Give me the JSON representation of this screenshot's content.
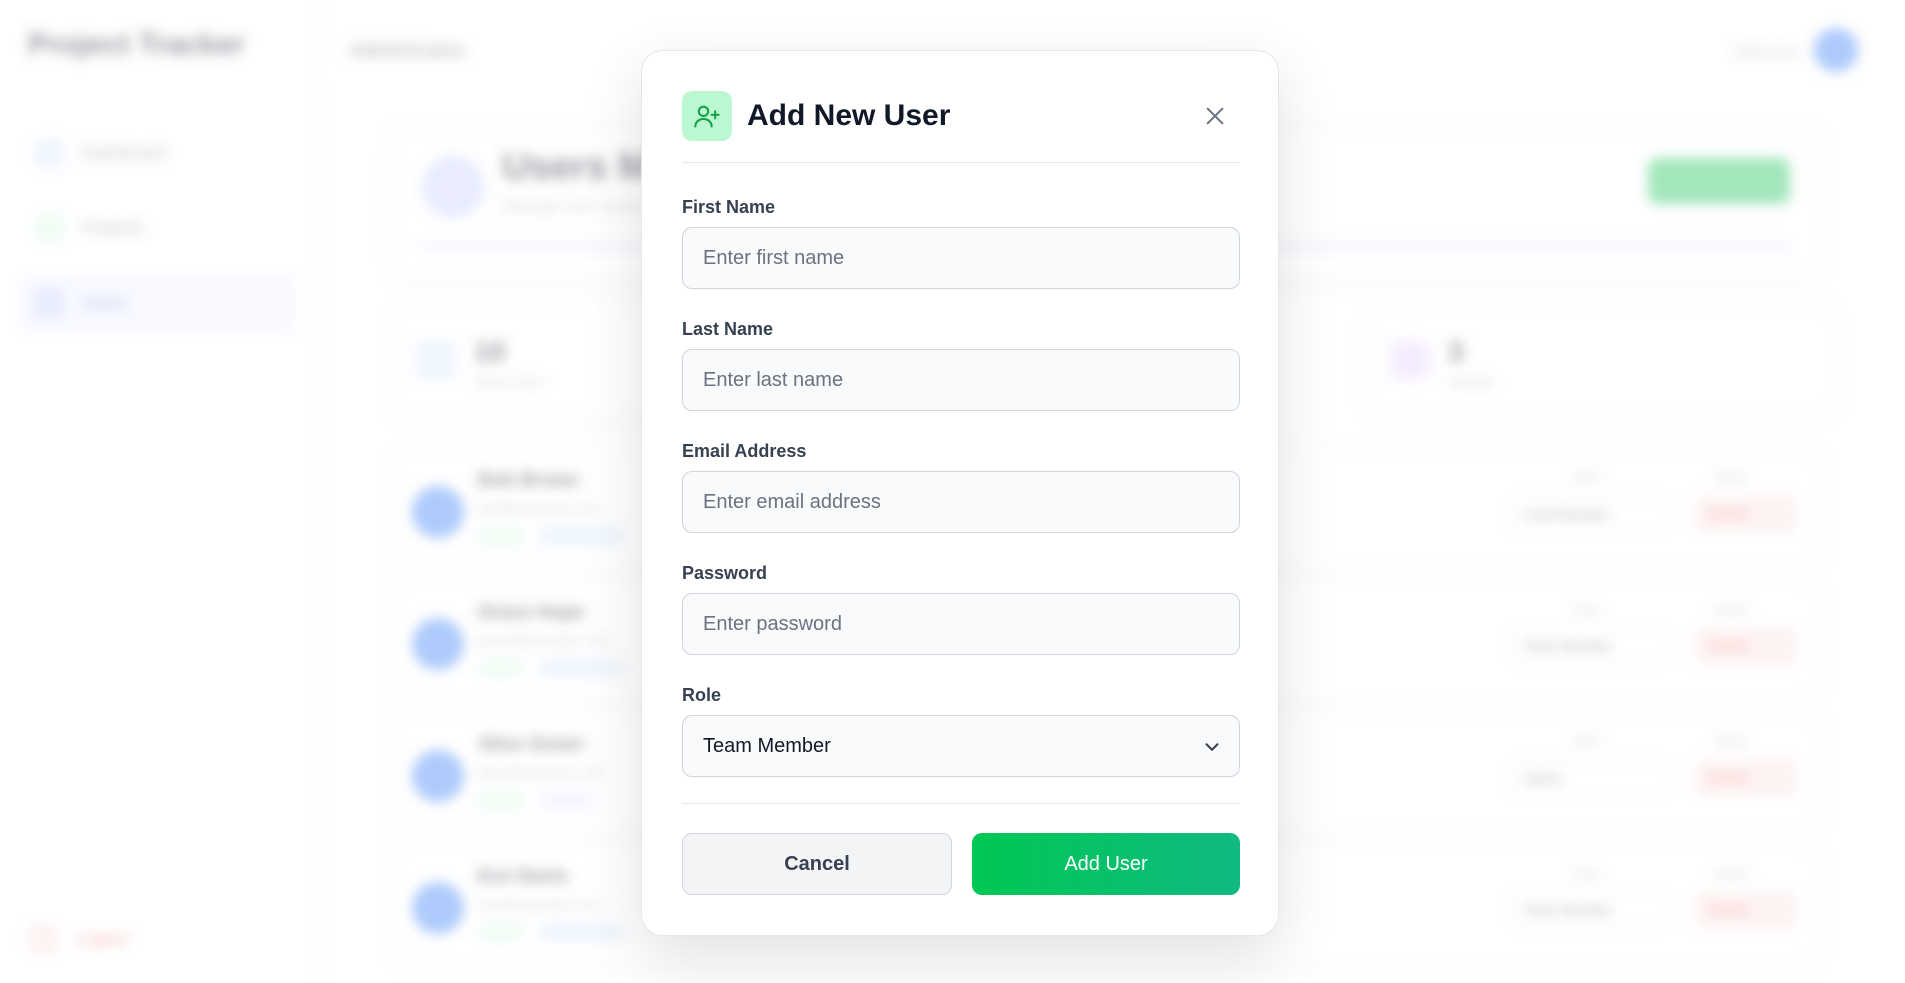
{
  "background": {
    "brand": "Project Tracker",
    "nav": [
      {
        "label": "Dashboard",
        "color": "#3b82f6"
      },
      {
        "label": "Projects",
        "color": "#22c55e"
      },
      {
        "label": "Users",
        "color": "#6366f1"
      }
    ],
    "logout_label": "Logout",
    "breadcrumb": "Admin/Users",
    "welcome": "Welcome",
    "header": {
      "title": "Users Management",
      "subtitle": "Manage user accounts and roles"
    },
    "stats": [
      {
        "number": "10",
        "label": "Total Users",
        "color": "#dbeafe"
      },
      {
        "number": "3",
        "label": "Admins",
        "color": "#e9d5ff"
      }
    ],
    "users": [
      {
        "name": "Bob Brown",
        "email": "bob@example.com",
        "role": "Lead Member",
        "action": "Delete"
      },
      {
        "name": "Grace Hope",
        "email": "grace@example.com",
        "role": "Team Member",
        "action": "Delete"
      },
      {
        "name": "Alice Green",
        "email": "alice@example.com",
        "role": "Admin",
        "action": "Delete"
      },
      {
        "name": "Eve Davis",
        "email": "eve@example.com",
        "role": "Team Member",
        "action": "Delete"
      }
    ],
    "role_label": "Role",
    "action_label": "Action"
  },
  "modal": {
    "title": "Add New User",
    "fields": {
      "first_name": {
        "label": "First Name",
        "placeholder": "Enter first name",
        "value": ""
      },
      "last_name": {
        "label": "Last Name",
        "placeholder": "Enter last name",
        "value": ""
      },
      "email": {
        "label": "Email Address",
        "placeholder": "Enter email address",
        "value": ""
      },
      "password": {
        "label": "Password",
        "placeholder": "Enter password",
        "value": ""
      },
      "role": {
        "label": "Role",
        "selected": "Team Member"
      }
    },
    "cancel_label": "Cancel",
    "submit_label": "Add User",
    "icon": "user-plus-icon",
    "colors": {
      "accent": "#00c853",
      "icon_bg": "#bbf7d0",
      "icon_stroke": "#16a34a"
    }
  }
}
